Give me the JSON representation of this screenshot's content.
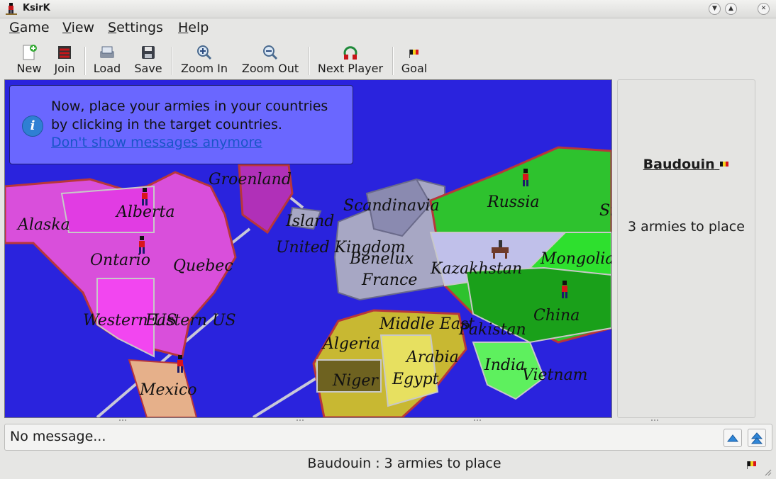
{
  "window": {
    "title": "KsirK"
  },
  "menu": {
    "game_rest": "ame",
    "game_ul": "G",
    "view_rest": "iew",
    "view_ul": "V",
    "settings_rest": "ettings",
    "settings_ul": "S",
    "help_rest": "elp",
    "help_ul": "H"
  },
  "toolbar": {
    "new": "New",
    "join": "Join",
    "load": "Load",
    "save": "Save",
    "zoom_in": "Zoom In",
    "zoom_out": "Zoom Out",
    "next_player": "Next Player",
    "goal": "Goal"
  },
  "info": {
    "line1": "Now, place your armies in your countries",
    "line2": "by clicking in the target countries.",
    "link": "Don't show messages anymore"
  },
  "map": {
    "countries": [
      "Groenland",
      "Alberta",
      "Alaska",
      "Ontario",
      "Quebec",
      "Western US",
      "Eastern US",
      "Mexico",
      "Island",
      "Scandinavia",
      "United Kingdom",
      "Benelux",
      "Russia",
      "France",
      "Kazakhstan",
      "Mongolia",
      "China",
      "Middle East",
      "Pakistan",
      "India",
      "Vietnam",
      "Algeria",
      "Niger",
      "Arabia",
      "Egypt",
      "Siberia"
    ]
  },
  "side": {
    "player": "Baudouin",
    "armies": "3 armies to place"
  },
  "message": {
    "text": "No message..."
  },
  "status": {
    "text": "Baudouin : 3 armies to place"
  },
  "colors": {
    "ocean": "#2a23dd",
    "north_america": "#e13ce3",
    "europe": "#a7a7c4",
    "asia": "#2ec22e",
    "africa": "#c8b832"
  }
}
